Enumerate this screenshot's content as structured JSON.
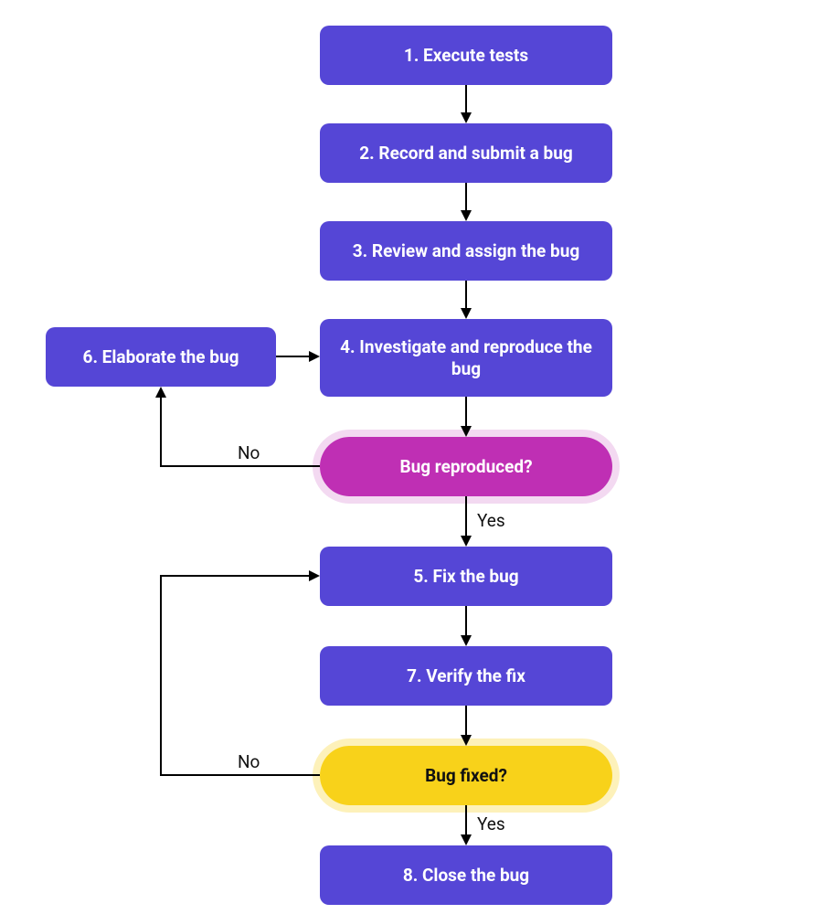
{
  "nodes": {
    "n1": "1.  Execute tests",
    "n2": "2.  Record and submit a bug",
    "n3": "3.  Review and assign the bug",
    "n4": "4.  Investigate and reproduce the bug",
    "d1": "Bug reproduced?",
    "n5": "5.  Fix the bug",
    "n6": "6.  Elaborate the bug",
    "n7": "7.  Verify the fix",
    "d2": "Bug fixed?",
    "n8": "8.  Close the bug"
  },
  "labels": {
    "d1_no": "No",
    "d1_yes": "Yes",
    "d2_no": "No",
    "d2_yes": "Yes"
  },
  "colors": {
    "process_bg": "#5546d6",
    "decision_purple": "#bf2fb4",
    "decision_yellow": "#f8d21a"
  }
}
